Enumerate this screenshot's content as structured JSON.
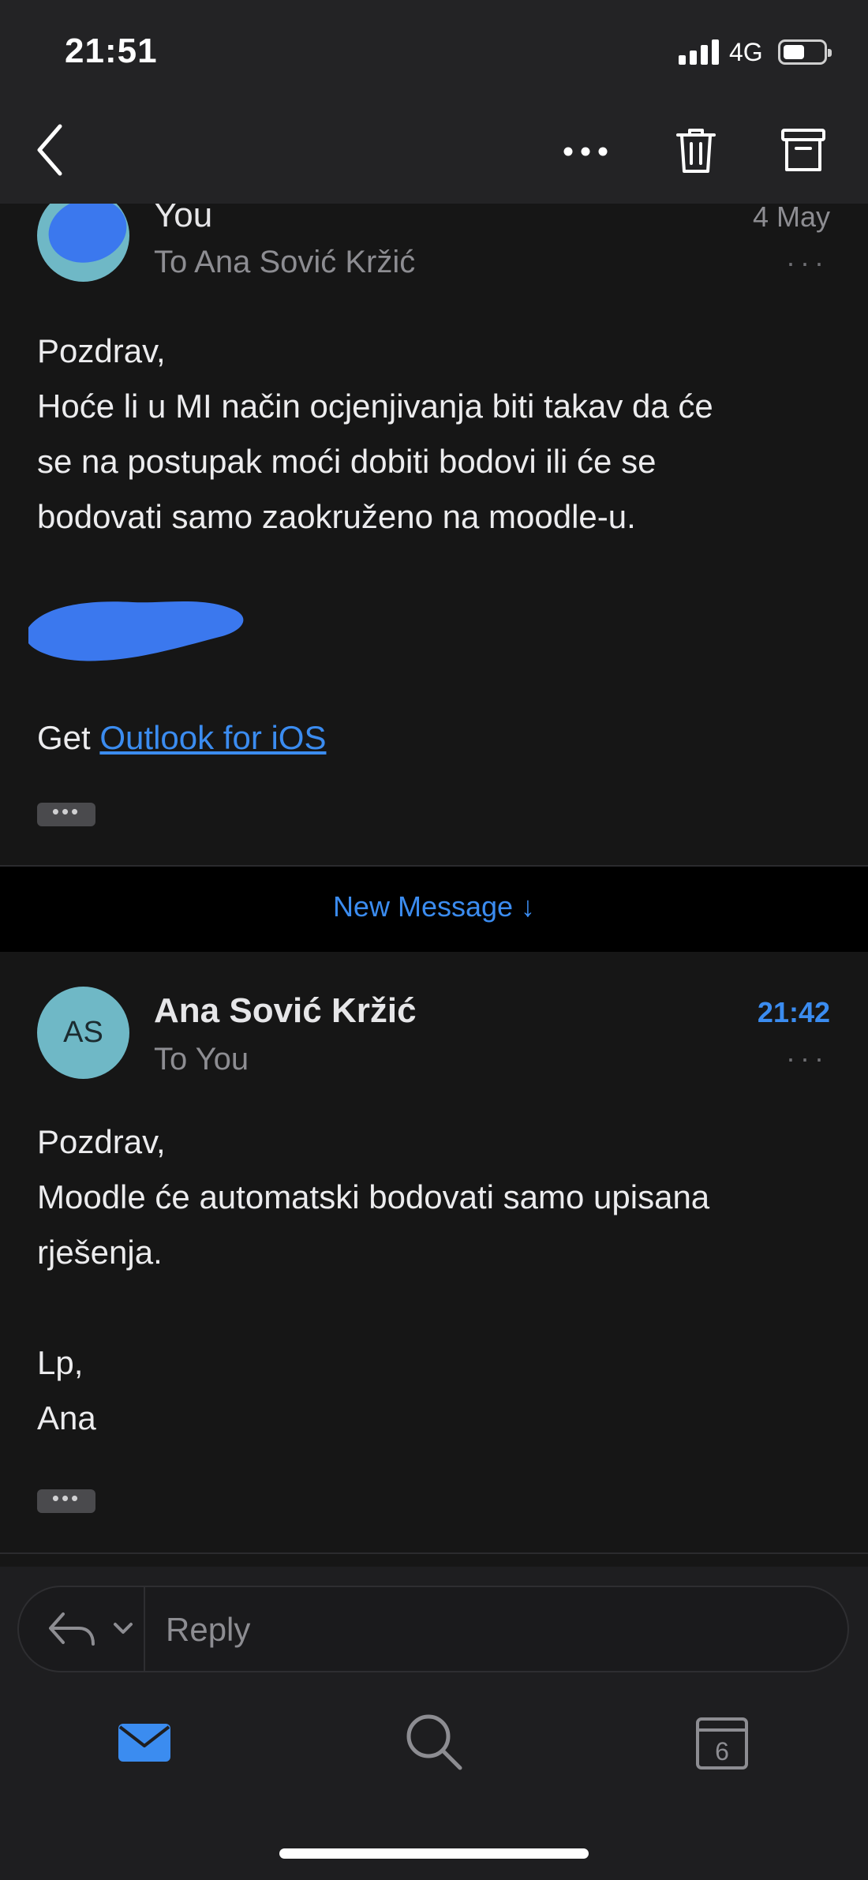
{
  "status_bar": {
    "time": "21:51",
    "network": "4G"
  },
  "thread": [
    {
      "sender": "You",
      "recipient": "To Ana Sović Kržić",
      "date": "4 May",
      "body": [
        "Pozdrav,",
        "Hoće li u MI način ocjenjivanja biti takav da će",
        "se na postupak moći dobiti bodovi ili će se",
        "bodovati samo zaokruženo na moodle-u."
      ],
      "signature_prefix": "Get ",
      "signature_link": "Outlook for iOS"
    },
    {
      "sender": "Ana Sović Kržić",
      "initials": "AS",
      "recipient": "To You",
      "date": "21:42",
      "body": [
        "Pozdrav,",
        "Moodle će automatski bodovati samo upisana",
        "rješenja.",
        "",
        "Lp,",
        "Ana"
      ]
    }
  ],
  "new_message_label": "New Message ↓",
  "reply": {
    "placeholder": "Reply"
  },
  "calendar_day": "6",
  "colors": {
    "accent": "#3b8cf0",
    "background": "#161616",
    "toolbar": "#232325",
    "avatar": "#6fb8c6"
  }
}
